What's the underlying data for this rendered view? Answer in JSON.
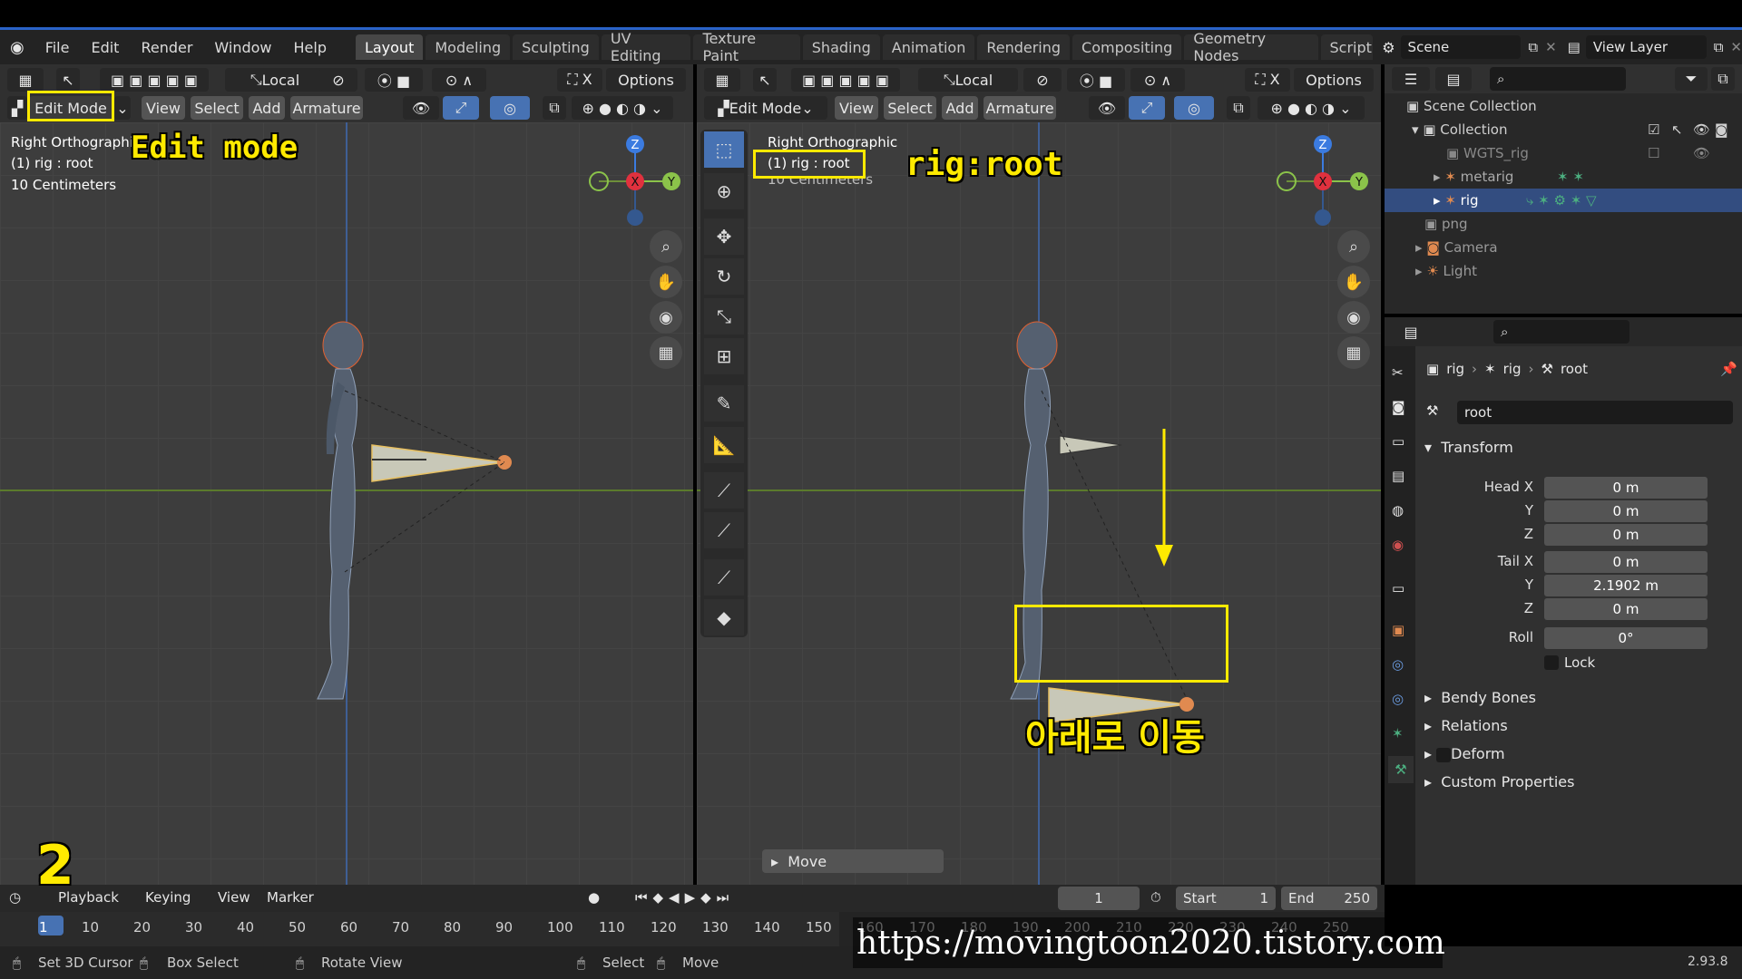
{
  "menu": {
    "items": [
      "File",
      "Edit",
      "Render",
      "Window",
      "Help"
    ],
    "workspaces": [
      "Layout",
      "Modeling",
      "Sculpting",
      "UV Editing",
      "Texture Paint",
      "Shading",
      "Animation",
      "Rendering",
      "Compositing",
      "Geometry Nodes",
      "Scriptin"
    ],
    "active_workspace": "Layout",
    "scene": "Scene",
    "view_layer": "View Layer"
  },
  "viewport_left": {
    "transform_orientation": "Local",
    "options": "Options",
    "mode": "Edit Mode",
    "menus": [
      "View",
      "Select",
      "Add",
      "Armature"
    ],
    "view_name": "Right Orthographic",
    "active": "(1) rig : root",
    "scale": "10 Centimeters",
    "annotation": "Edit mode",
    "step_number": "2"
  },
  "viewport_right": {
    "transform_orientation": "Local",
    "options": "Options",
    "mode": "Edit Mode",
    "menus": [
      "View",
      "Select",
      "Add",
      "Armature"
    ],
    "view_name": "Right Orthographic",
    "active": "(1) rig : root",
    "scale": "10 Centimeters",
    "annotation_top": "rig:root",
    "annotation_bottom": "아래로 이동",
    "last_op": "Move"
  },
  "gizmo": {
    "z": "Z",
    "x": "X",
    "y": "Y"
  },
  "outliner": {
    "root": "Scene Collection",
    "items": [
      {
        "label": "Collection",
        "indent": 1
      },
      {
        "label": "WGTS_rig",
        "indent": 2
      },
      {
        "label": "metarig",
        "indent": 2
      },
      {
        "label": "rig",
        "indent": 2
      },
      {
        "label": "png",
        "indent": 1
      },
      {
        "label": "Camera",
        "indent": 1
      },
      {
        "label": "Light",
        "indent": 1
      }
    ]
  },
  "properties": {
    "breadcrumb": [
      "rig",
      "rig",
      "root"
    ],
    "bone_name": "root",
    "transform_title": "Transform",
    "head_x_label": "Head X",
    "head_x": "0 m",
    "head_y_label": "Y",
    "head_y": "0 m",
    "head_z_label": "Z",
    "head_z": "0 m",
    "tail_x_label": "Tail X",
    "tail_x": "0 m",
    "tail_y_label": "Y",
    "tail_y": "2.1902 m",
    "tail_z_label": "Z",
    "tail_z": "0 m",
    "roll_label": "Roll",
    "roll": "0°",
    "lock": "Lock",
    "sections": [
      "Bendy Bones",
      "Relations",
      "Deform",
      "Custom Properties"
    ]
  },
  "timeline": {
    "playback": "Playback",
    "keying": "Keying",
    "view": "View",
    "marker": "Marker",
    "current_frame": "1",
    "start_label": "Start",
    "start": "1",
    "end_label": "End",
    "end": "250",
    "ticks": [
      "1",
      "10",
      "20",
      "30",
      "40",
      "50",
      "60",
      "70",
      "80",
      "90",
      "100",
      "110",
      "120",
      "130",
      "140",
      "150",
      "160",
      "170",
      "180",
      "190",
      "200",
      "210",
      "220",
      "230",
      "240",
      "250"
    ]
  },
  "status": {
    "set_cursor": "Set 3D Cursor",
    "box_select": "Box Select",
    "rotate_view": "Rotate View",
    "select": "Select",
    "move": "Move",
    "version": "2.93.8",
    "watermark": "https://movingtoon2020.tistory.com"
  },
  "colors": {
    "accent": "#4772b3",
    "annotation": "#ffea00",
    "axis_x": "#e0313e",
    "axis_y": "#8bc34a",
    "axis_z": "#3b7be0"
  }
}
